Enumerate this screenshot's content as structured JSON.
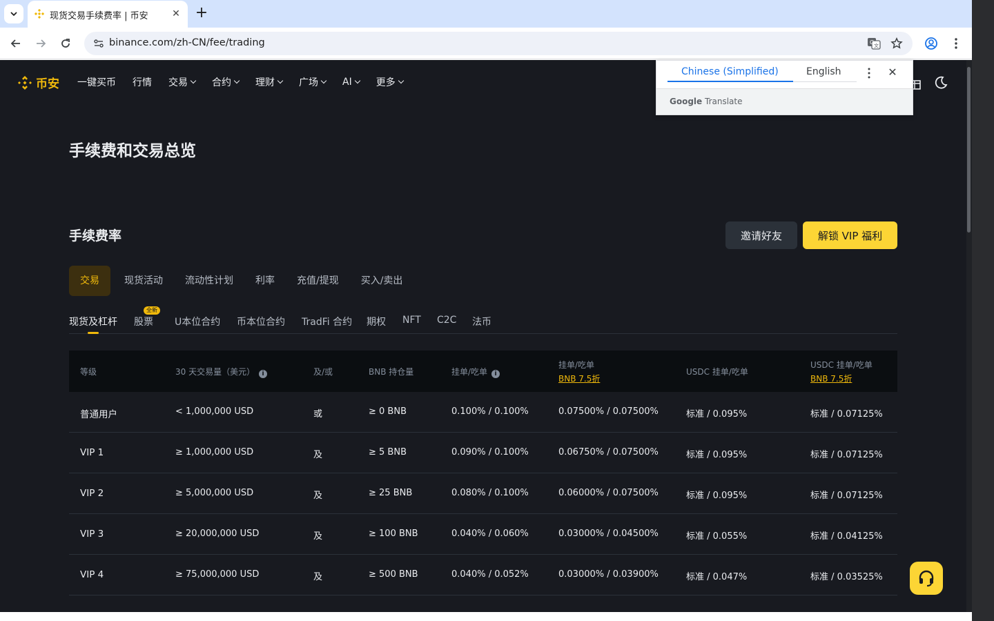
{
  "browser": {
    "tab_title": "现货交易手续费率 | 币安",
    "url": "binance.com/zh-CN/fee/trading"
  },
  "site": {
    "logo_text": "币安",
    "nav": [
      "一键买币",
      "行情",
      "交易",
      "合约",
      "理财",
      "广场",
      "AI",
      "更多"
    ],
    "nav_has_dropdown": [
      false,
      false,
      true,
      true,
      true,
      true,
      true,
      true
    ]
  },
  "page": {
    "title": "手续费和交易总览",
    "section_title": "手续费率",
    "invite_button": "邀请好友",
    "vip_button": "解锁 VIP 福利",
    "category_tabs": [
      "交易",
      "现货活动",
      "流动性计划",
      "利率",
      "充值/提现",
      "买入/卖出"
    ],
    "active_category": "交易",
    "sub_tabs": [
      "现货及杠杆",
      "股票",
      "U本位合约",
      "币本位合约",
      "TradFi 合约",
      "期权",
      "NFT",
      "C2C",
      "法币"
    ],
    "active_sub_tab": "现货及杠杆",
    "new_badge": "全新"
  },
  "table": {
    "headers": {
      "level": "等级",
      "volume": "30 天交易量（美元）",
      "andor": "及/或",
      "bnb": "BNB 持仓量",
      "maker_taker": "挂单/吃单",
      "maker_taker_bnb": "挂单/吃单",
      "bnb_discount": "BNB 7.5折",
      "usdc": "USDC 挂单/吃单",
      "usdc_bnb": "USDC 挂单/吃单",
      "usdc_bnb_discount": "BNB 7.5折"
    },
    "rows": [
      {
        "level": "普通用户",
        "volume": "< 1,000,000 USD",
        "andor": "或",
        "bnb": "≥ 0 BNB",
        "mt": "0.100% / 0.100%",
        "mt_bnb": "0.07500% / 0.07500%",
        "usdc": "标准 / 0.095%",
        "usdc_bnb": "标准 / 0.07125%"
      },
      {
        "level": "VIP 1",
        "volume": "≥ 1,000,000 USD",
        "andor": "及",
        "bnb": "≥ 5 BNB",
        "mt": "0.090% / 0.100%",
        "mt_bnb": "0.06750% / 0.07500%",
        "usdc": "标准 / 0.095%",
        "usdc_bnb": "标准 / 0.07125%"
      },
      {
        "level": "VIP 2",
        "volume": "≥ 5,000,000 USD",
        "andor": "及",
        "bnb": "≥ 25 BNB",
        "mt": "0.080% / 0.100%",
        "mt_bnb": "0.06000% / 0.07500%",
        "usdc": "标准 / 0.095%",
        "usdc_bnb": "标准 / 0.07125%"
      },
      {
        "level": "VIP 3",
        "volume": "≥ 20,000,000 USD",
        "andor": "及",
        "bnb": "≥ 100 BNB",
        "mt": "0.040% / 0.060%",
        "mt_bnb": "0.03000% / 0.04500%",
        "usdc": "标准 / 0.055%",
        "usdc_bnb": "标准 / 0.04125%"
      },
      {
        "level": "VIP 4",
        "volume": "≥ 75,000,000 USD",
        "andor": "及",
        "bnb": "≥ 500 BNB",
        "mt": "0.040% / 0.052%",
        "mt_bnb": "0.03000% / 0.03900%",
        "usdc": "标准 / 0.047%",
        "usdc_bnb": "标准 / 0.03525%"
      }
    ]
  },
  "translate_popup": {
    "source_lang": "Chinese (Simplified)",
    "target_lang": "English",
    "brand_google": "Google",
    "brand_translate": "Translate"
  },
  "colors": {
    "brand_yellow": "#f0b90b",
    "button_yellow": "#fcd535",
    "page_bg": "#181a20",
    "google_blue": "#1a73e8"
  }
}
